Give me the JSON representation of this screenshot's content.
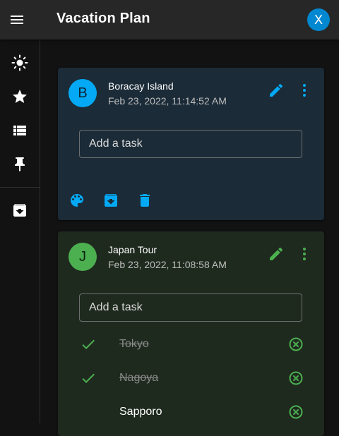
{
  "app": {
    "title": "Vacation Plan",
    "user_initial": "X"
  },
  "sidebar": {
    "items": [
      {
        "name": "theme",
        "icon": "brightness-icon"
      },
      {
        "name": "starred",
        "icon": "star-icon"
      },
      {
        "name": "list",
        "icon": "list-icon"
      },
      {
        "name": "pinned",
        "icon": "pin-icon"
      },
      {
        "name": "archive",
        "icon": "archive-icon"
      }
    ]
  },
  "cards": [
    {
      "initial": "B",
      "title": "Boracay Island",
      "date": "Feb 23, 2022, 11:14:52 AM",
      "accent": "#03a9f4",
      "task_placeholder": "Add a task",
      "tasks": []
    },
    {
      "initial": "J",
      "title": "Japan Tour",
      "date": "Feb 23, 2022, 11:08:58 AM",
      "accent": "#4caf50",
      "task_placeholder": "Add a task",
      "tasks": [
        {
          "label": "Tokyo",
          "done": true
        },
        {
          "label": "Nagoya",
          "done": true
        },
        {
          "label": "Sapporo",
          "done": false
        }
      ]
    }
  ],
  "colors": {
    "appbar": "#272727",
    "background": "#121212",
    "card_blue_bg": "#1b2b38",
    "card_green_bg": "#1f2a1f",
    "avatar_blue": "#0288d1"
  }
}
